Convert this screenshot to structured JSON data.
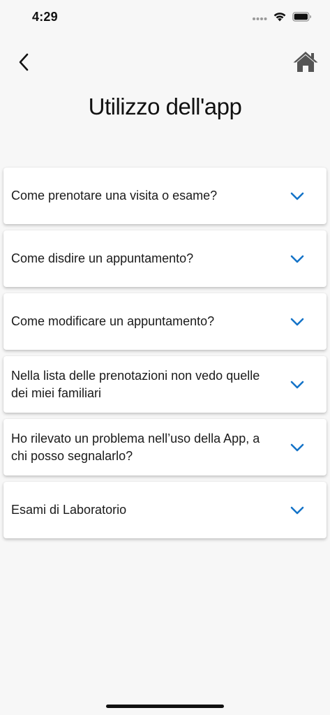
{
  "status": {
    "time": "4:29",
    "icons": [
      "signal-dots-icon",
      "wifi-icon",
      "battery-icon"
    ]
  },
  "nav": {
    "back_icon": "chevron-left-icon",
    "home_icon": "home-icon"
  },
  "title": "Utilizzo dell'app",
  "colors": {
    "background": "#f7f7f7",
    "card": "#ffffff",
    "accent": "#1473c8",
    "home_icon": "#555555"
  },
  "faq": {
    "items": [
      {
        "question": "Come prenotare una visita o esame?"
      },
      {
        "question": "Come disdire un appuntamento?"
      },
      {
        "question": "Come modificare un appuntamento?"
      },
      {
        "question": "Nella lista delle prenotazioni non vedo quelle dei miei familiari"
      },
      {
        "question": "Ho rilevato un problema nell’uso della App, a chi posso segnalarlo?"
      },
      {
        "question": "Esami di Laboratorio"
      }
    ]
  }
}
